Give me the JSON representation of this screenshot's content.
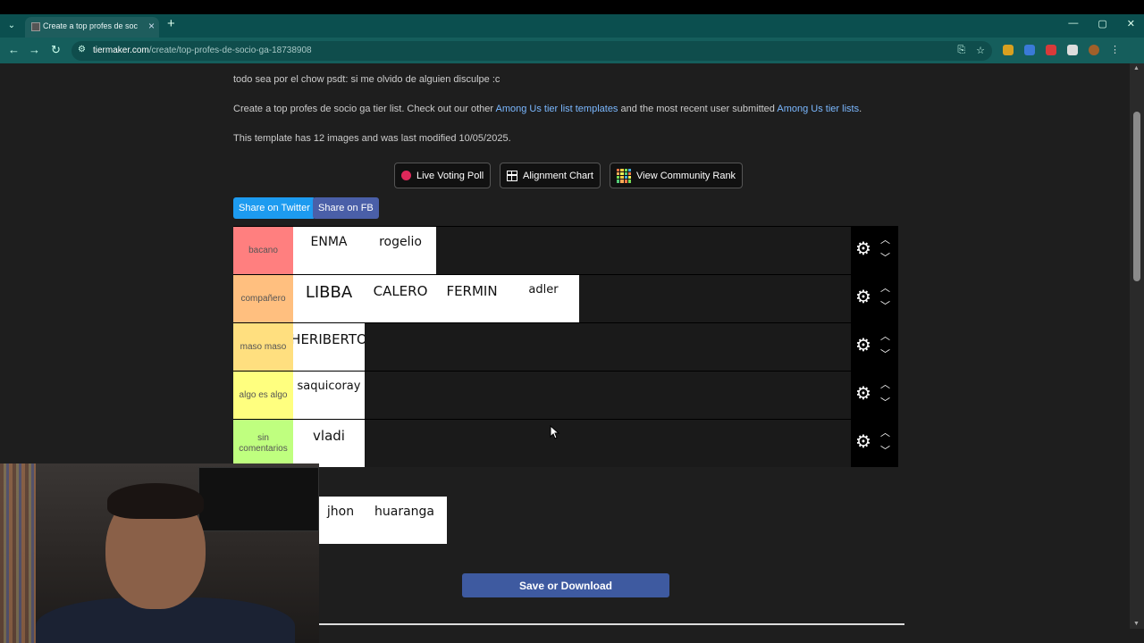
{
  "browser": {
    "tab_title": "Create a top profes de socio ga",
    "tab_close": "×",
    "new_tab": "+",
    "url_host": "tiermaker.com",
    "url_path": "/create/top-profes-de-socio-ga-18738908",
    "window_controls": [
      "—",
      "▢",
      "✕"
    ]
  },
  "page": {
    "intro_line": "todo sea por el chow psdt: si me olvido de alguien disculpe :c",
    "create_text_a": "Create a top profes de socio ga tier list. Check out our other ",
    "create_link_a": "Among Us tier list templates",
    "create_text_b": " and the most recent user submitted ",
    "create_link_b": "Among Us tier lists",
    "create_text_c": ".",
    "template_info": "This template has 12 images and was last modified 10/05/2025.",
    "buttons": {
      "live_voting": "Live Voting Poll",
      "alignment": "Alignment Chart",
      "community_rank": "View Community Rank"
    },
    "share": {
      "twitter": "Share on Twitter",
      "facebook": "Share on FB"
    },
    "tiers": [
      {
        "label": "bacano",
        "color": "#ff7f7f",
        "items": [
          "ENMA",
          "rogelio"
        ]
      },
      {
        "label": "compañero",
        "color": "#ffbf7f",
        "items": [
          "LIBBA",
          "CALERO",
          "FERMIN",
          "adler"
        ]
      },
      {
        "label": "maso maso",
        "color": "#ffdf7f",
        "items": [
          "HERIBERTO"
        ]
      },
      {
        "label": "algo es algo",
        "color": "#ffff7f",
        "items": [
          "saquicoray"
        ]
      },
      {
        "label": "sin comentarios",
        "color": "#bfff7f",
        "items": [
          "vladi"
        ]
      }
    ],
    "pool_items": [
      "jhon",
      "huaranga"
    ],
    "save_button": "Save or Download"
  }
}
